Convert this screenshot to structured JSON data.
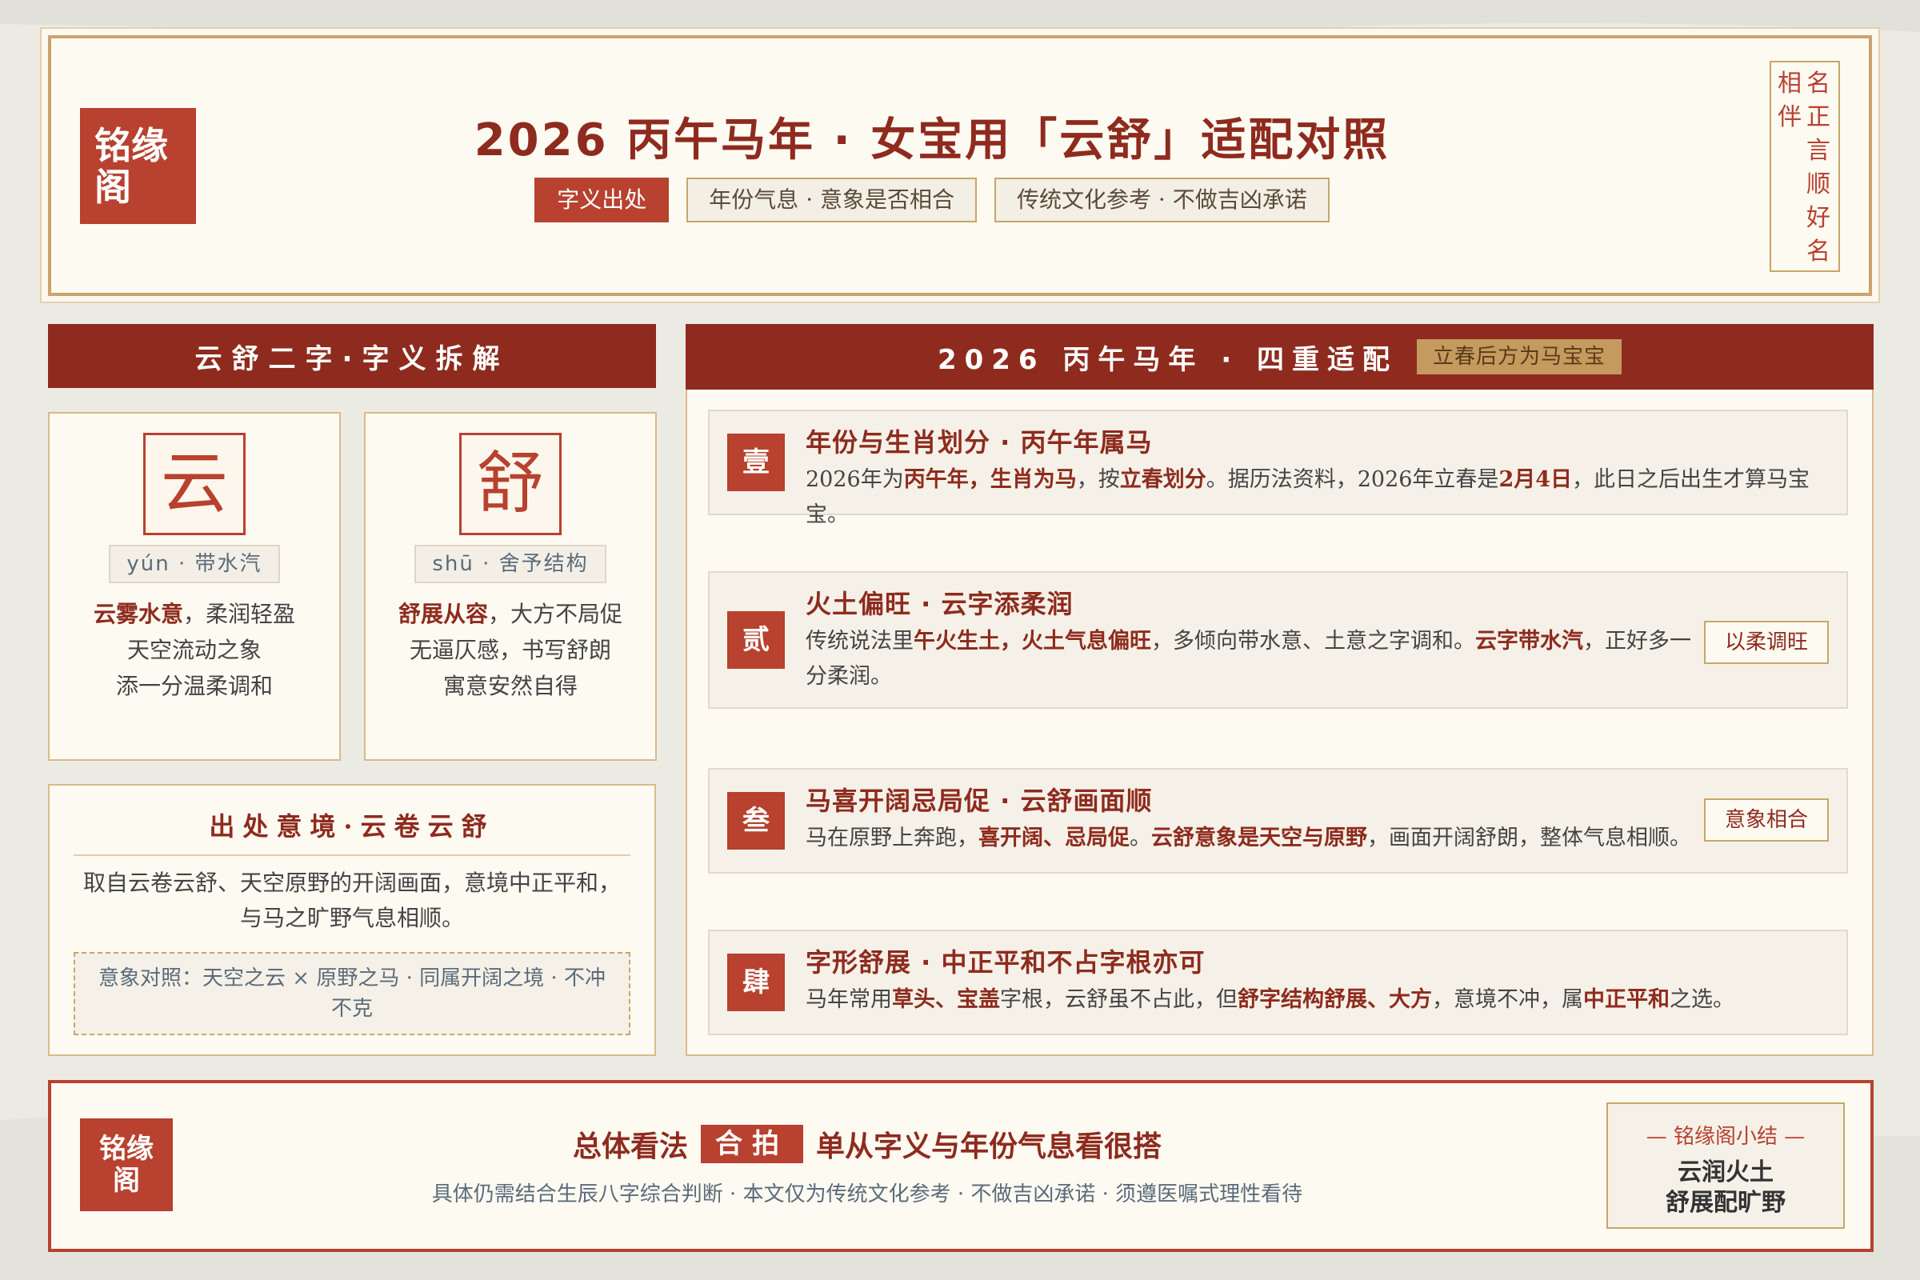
{
  "header": {
    "logo_line1": "铭缘",
    "logo_line2": "阁",
    "title": "2026 丙午马年 · 女宝用「云舒」适配对照",
    "tags": [
      "字义出处",
      "年份气息 · 意象是否相合",
      "传统文化参考 · 不做吉凶承诺"
    ],
    "seal_col_right": [
      "名",
      "正",
      "言",
      "顺",
      "好",
      "名"
    ],
    "seal_col_left": [
      "相",
      "伴"
    ]
  },
  "left": {
    "section_title": "云舒二字·字义拆解",
    "chars": [
      {
        "char": "云",
        "pinyin": "yún · 带水汽",
        "line1_hl": "云雾水意",
        "line1_rest": "，柔润轻盈",
        "line2": "天空流动之象",
        "line3": "添一分温柔调和"
      },
      {
        "char": "舒",
        "pinyin": "shū · 舍予结构",
        "line1_hl": "舒展从容",
        "line1_rest": "，大方不局促",
        "line2": "无逼仄感，书写舒朗",
        "line3": "寓意安然自得"
      }
    ],
    "source": {
      "title": "出处意境·云卷云舒",
      "text": "取自云卷云舒、天空原野的开阔画面，意境中正平和，与马之旷野气息相顺。",
      "box": "意象对照：天空之云 × 原野之马 · 同属开阔之境 · 不冲不克"
    }
  },
  "right": {
    "section_title": "2026 丙午马年 · 四重适配",
    "badge": "立春后方为马宝宝",
    "rules": [
      {
        "num": "壹",
        "title": "年份与生肖划分 · 丙午年属马",
        "body": [
          {
            "t": "2026年为"
          },
          {
            "t": "丙午年，生肖为马",
            "hl": true
          },
          {
            "t": "，按"
          },
          {
            "t": "立春划分",
            "hl": true
          },
          {
            "t": "。据历法资料，2026年立春是"
          },
          {
            "t": "2月4日",
            "hl": true
          },
          {
            "t": "，此日之后出生才算马宝宝。"
          }
        ]
      },
      {
        "num": "贰",
        "title": "火土偏旺 · 云字添柔润",
        "body": [
          {
            "t": "传统说法里"
          },
          {
            "t": "午火生土，火土气息偏旺",
            "hl": true
          },
          {
            "t": "，多倾向带水意、土意之字调和。"
          },
          {
            "t": "云字带水汽",
            "hl": true
          },
          {
            "t": "，正好多一分柔润。"
          }
        ],
        "badge": "以柔调旺"
      },
      {
        "num": "叁",
        "title": "马喜开阔忌局促 · 云舒画面顺",
        "body": [
          {
            "t": "马在原野上奔跑，"
          },
          {
            "t": "喜开阔、忌局促",
            "hl": true
          },
          {
            "t": "。"
          },
          {
            "t": "云舒意象是天空与原野",
            "hl": true
          },
          {
            "t": "，画面开阔舒朗，整体气息相顺。"
          }
        ],
        "badge": "意象相合"
      },
      {
        "num": "肆",
        "title": "字形舒展 · 中正平和不占字根亦可",
        "body": [
          {
            "t": "马年常用"
          },
          {
            "t": "草头、宝盖",
            "hl": true
          },
          {
            "t": "字根，云舒虽不占此，但"
          },
          {
            "t": "舒字结构舒展、大方",
            "hl": true
          },
          {
            "t": "，意境不冲，属"
          },
          {
            "t": "中正平和",
            "hl": true
          },
          {
            "t": "之选。"
          }
        ]
      }
    ]
  },
  "footer": {
    "logo_line1": "铭缘",
    "logo_line2": "阁",
    "lead": "总体看法",
    "verdict": "合拍",
    "conclusion": "单从字义与年份气息看很搭",
    "note": "具体仍需结合生辰八字综合判断 · 本文仅为传统文化参考 · 不做吉凶承诺 · 须遵医嘱式理性看待",
    "summary_label": "— 铭缘阁小结 —",
    "summary_line1": "云润火土",
    "summary_line2": "舒展配旷野"
  },
  "colors": {
    "primary": "#8e2b1e",
    "accent": "#b8412f",
    "gold": "#c9a56b",
    "paper": "#fdfaf2"
  }
}
